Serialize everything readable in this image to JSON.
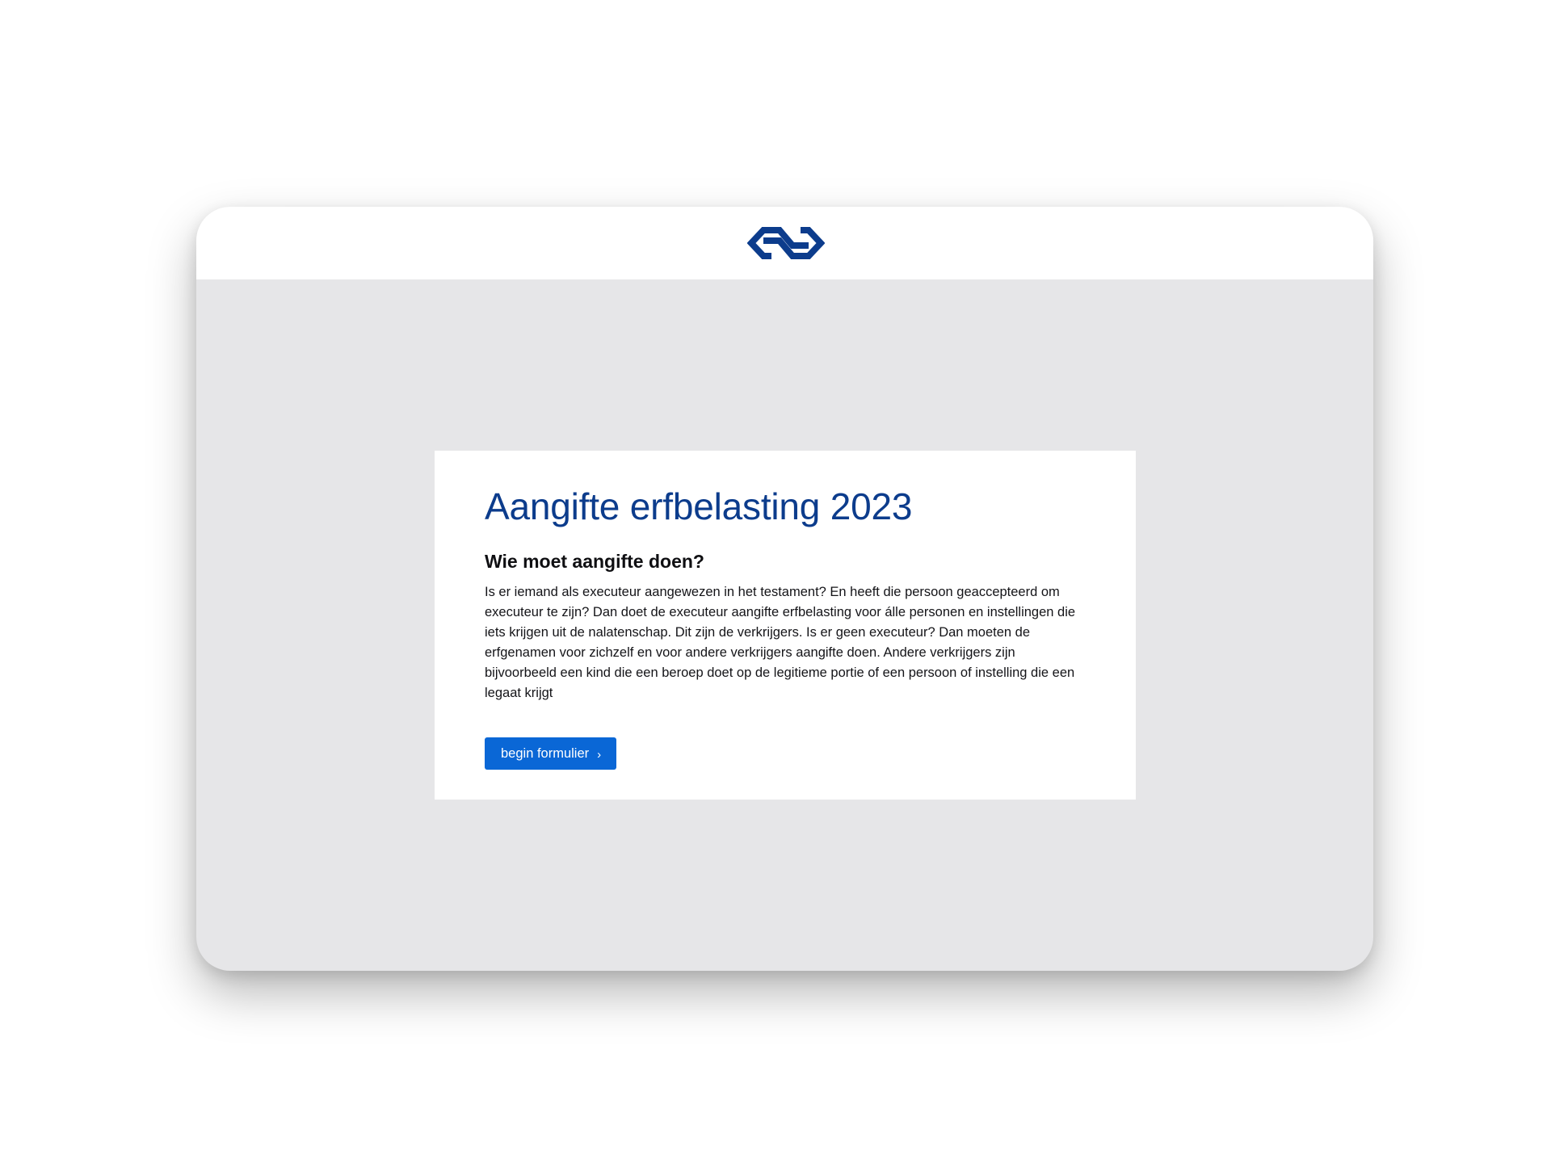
{
  "header": {
    "logo_icon": "ns-logo-icon",
    "brand_color": "#0c3c8c"
  },
  "main": {
    "title": "Aangifte erfbelasting 2023",
    "heading": "Wie moet aangifte doen?",
    "body": "Is er iemand als executeur aangewezen in het testament? En heeft die persoon geaccepteerd om executeur te zijn? Dan doet de executeur aangifte erfbelasting voor álle personen en instellingen die iets krijgen uit de nalatenschap. Dit zijn de verkrijgers. Is er geen executeur? Dan moeten de erfgenamen voor zichzelf en voor andere verkrijgers aangifte doen. Andere verkrijgers zijn bijvoorbeeld een kind die een beroep doet op de legitieme portie of een persoon of instelling die een legaat krijgt",
    "button_label": "begin formulier",
    "button_icon": "chevron-right-icon",
    "button_glyph": "›"
  },
  "colors": {
    "page_background": "#e6e6e8",
    "card_background": "#ffffff",
    "button_background": "#0a67d6"
  }
}
